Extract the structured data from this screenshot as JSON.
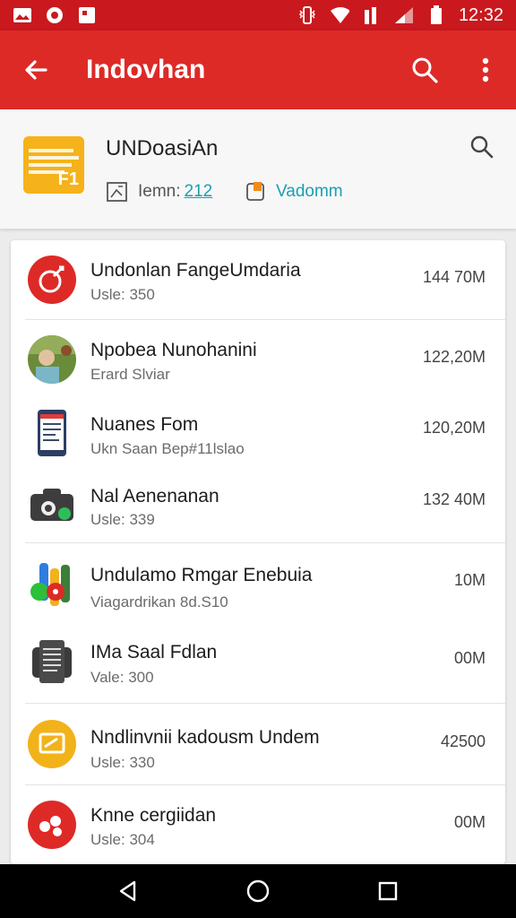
{
  "status_bar": {
    "time": "12:32",
    "icons": [
      "gallery-icon",
      "opera-icon",
      "photo-icon",
      "vibrate-icon",
      "wifi-icon",
      "signal-icon",
      "battery-icon"
    ]
  },
  "app_bar": {
    "title": "Indovhan",
    "back_icon": "arrow-back-icon",
    "search_icon": "search-icon",
    "menu_icon": "more-vert-icon",
    "color": "#dd2a27"
  },
  "header": {
    "app_name": "UNDoasiAn",
    "logo_color": "#f6b21a",
    "logo_text": "F1",
    "meta_label": "Iemn:",
    "meta_value": "212",
    "brand": "Vadomm"
  },
  "list": [
    {
      "name": "Undonlan FangeUmdaria",
      "sub": "Usle: 350",
      "size": "144 70M",
      "icon": "red-circle-icon"
    },
    {
      "name": "Npobea Nunohanini",
      "sub": "Erard Slviar",
      "size": "122,20M",
      "icon": "avatar-photo-icon"
    },
    {
      "name": "Nuanes Fom",
      "sub": "Ukn Saan Bep#11lslao",
      "size": "120,20M",
      "icon": "phone-document-icon"
    },
    {
      "name": "Nal Aenenanan",
      "sub": "Usle: 339",
      "size": "132 40M",
      "icon": "camera-bag-icon"
    },
    {
      "name": "Undulamo Rmgar Enebuia",
      "sub": "Viagardrikan 8d.S10",
      "size": "10M",
      "icon": "colorful-apps-icon"
    },
    {
      "name": "IMa Saal Fdlan",
      "sub": "Vale: 300",
      "size": "00M",
      "icon": "document-stack-icon"
    },
    {
      "name": "Nndlinvnii kadousm Undem",
      "sub": "Usle: 330",
      "size": "42500",
      "icon": "yellow-card-icon"
    },
    {
      "name": "Knne cergiidan",
      "sub": "Usle: 304",
      "size": "00M",
      "icon": "red-dots-icon"
    }
  ],
  "nav_bar": {
    "back": "nav-back-icon",
    "home": "nav-home-icon",
    "recents": "nav-recents-icon"
  }
}
